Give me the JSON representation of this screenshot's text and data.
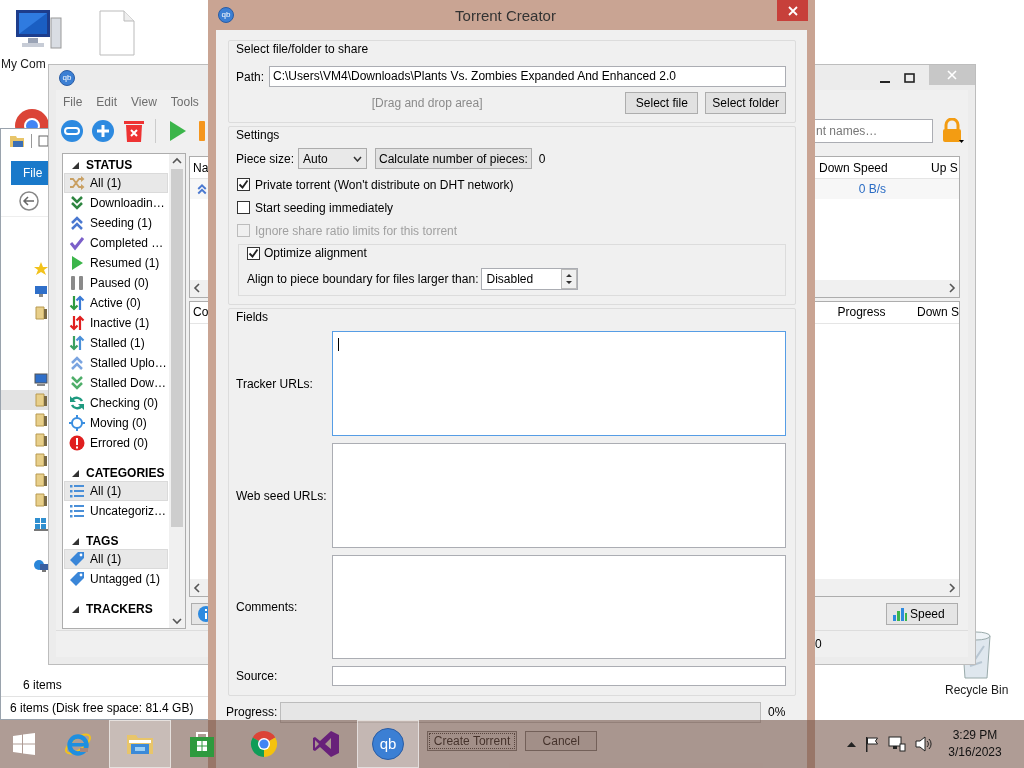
{
  "desktop": {
    "icons": [
      {
        "kind": "computer",
        "label": "My Com"
      },
      {
        "kind": "file"
      },
      {
        "kind": "browser"
      },
      {
        "kind": "recycle-bin",
        "label": "Recycle Bin"
      }
    ]
  },
  "explorer": {
    "ribbon_tab": "File",
    "navigation_pane": [
      {
        "kind": "favorites",
        "selected": false
      },
      {
        "kind": "desktop",
        "selected": false
      },
      {
        "kind": "folder",
        "selected": false
      },
      {
        "kind": "this-pc",
        "selected": false
      },
      {
        "kind": "folder",
        "selected": true
      },
      {
        "kind": "folder",
        "selected": false
      },
      {
        "kind": "folder",
        "selected": false
      },
      {
        "kind": "folder",
        "selected": false
      },
      {
        "kind": "folder",
        "selected": false
      },
      {
        "kind": "folder",
        "selected": false
      },
      {
        "kind": "drive",
        "selected": false
      },
      {
        "kind": "network",
        "selected": false
      }
    ],
    "item_count": "6 items",
    "status_bar": "6 items (Disk free space: 81.4 GB)"
  },
  "qbittorrent": {
    "icon_text": "qb",
    "menu": [
      "File",
      "Edit",
      "View",
      "Tools"
    ],
    "toolbar": [
      {
        "kind": "add-link"
      },
      {
        "kind": "add"
      },
      {
        "kind": "delete"
      },
      {
        "kind": "separator"
      },
      {
        "kind": "resume"
      },
      {
        "kind": "pause"
      }
    ],
    "search": {
      "placeholder": "nt names…"
    },
    "sidebar": [
      {
        "title": "STATUS",
        "expanded": true,
        "items": [
          {
            "kind": "shuffle",
            "label": "All (1)",
            "selected": true
          },
          {
            "kind": "downloading",
            "label": "Downloadin…",
            "selected": false
          },
          {
            "kind": "seeding",
            "label": "Seeding (1)",
            "selected": false
          },
          {
            "kind": "completed",
            "label": "Completed …",
            "selected": false
          },
          {
            "kind": "resumed",
            "label": "Resumed (1)",
            "selected": false
          },
          {
            "kind": "paused",
            "label": "Paused (0)",
            "selected": false
          },
          {
            "kind": "active",
            "label": "Active (0)",
            "selected": false
          },
          {
            "kind": "inactive",
            "label": "Inactive (1)",
            "selected": false
          },
          {
            "kind": "stalled",
            "label": "Stalled (1)",
            "selected": false
          },
          {
            "kind": "stalled-uploading",
            "label": "Stalled Uplo…",
            "selected": false
          },
          {
            "kind": "stalled-downloading",
            "label": "Stalled Dow…",
            "selected": false
          },
          {
            "kind": "checking",
            "label": "Checking (0)",
            "selected": false
          },
          {
            "kind": "moving",
            "label": "Moving (0)",
            "selected": false
          },
          {
            "kind": "errored",
            "label": "Errored (0)",
            "selected": false
          }
        ]
      },
      {
        "title": "CATEGORIES",
        "expanded": true,
        "items": [
          {
            "kind": "category",
            "label": "All (1)",
            "selected": true
          },
          {
            "kind": "category",
            "label": "Uncategoriz…",
            "selected": false
          }
        ]
      },
      {
        "title": "TAGS",
        "expanded": true,
        "items": [
          {
            "kind": "tag",
            "label": "All (1)",
            "selected": true
          },
          {
            "kind": "tag",
            "label": "Untagged (1)",
            "selected": false
          }
        ]
      },
      {
        "title": "TRACKERS",
        "expanded": true
      }
    ],
    "transfers": {
      "columns": [
        "Na",
        "Down Speed",
        "Up S"
      ],
      "rows": [
        {
          "kind": "seeding",
          "down_speed": "0 B/s"
        }
      ]
    },
    "properties": {
      "columns": [
        "Co",
        "Progress",
        "Down S"
      ]
    },
    "speed_button": "Speed",
    "status_text": "0"
  },
  "torrent_creator": {
    "title": "Torrent Creator",
    "icon_text": "qb",
    "share": {
      "title": "Select file/folder to share",
      "path_label": "Path:",
      "path": "C:\\Users\\VM4\\Downloads\\Plants Vs. Zombies Expanded And Enhanced 2.0",
      "drop_hint": "[Drag and drop area]",
      "buttons": [
        "Select file",
        "Select folder"
      ]
    },
    "settings": {
      "title": "Settings",
      "piece_size_label": "Piece size:",
      "piece_size": "Auto",
      "calculate_button": "Calculate number of pieces:",
      "pieces_count": "0",
      "options": [
        {
          "label": "Private torrent (Won't distribute on DHT network)",
          "checked": true,
          "disabled": false
        },
        {
          "label": "Start seeding immediately",
          "checked": false,
          "disabled": false
        },
        {
          "label": "Ignore share ratio limits for this torrent",
          "checked": false,
          "disabled": true
        }
      ],
      "optimize": {
        "label": "Optimize alignment",
        "checked": true
      },
      "align_label": "Align to piece boundary for files larger than:",
      "align_value": "Disabled"
    },
    "fields": {
      "title": "Fields",
      "rows": [
        {
          "label": "Tracker URLs:",
          "kind": "multiline",
          "focused": true
        },
        {
          "label": "Web seed URLs:",
          "kind": "multiline",
          "focused": false
        },
        {
          "label": "Comments:",
          "kind": "multiline",
          "focused": false
        },
        {
          "label": "Source:",
          "kind": "line",
          "focused": false
        }
      ]
    },
    "progress": {
      "label": "Progress:",
      "level": 0,
      "reading": "0%"
    },
    "buttons": [
      "Create Torrent",
      "Cancel"
    ]
  },
  "taskbar": {
    "apps": [
      {
        "kind": "start",
        "active": false
      },
      {
        "kind": "internet-explorer",
        "active": false
      },
      {
        "kind": "file-explorer",
        "active": true
      },
      {
        "kind": "store",
        "active": false
      },
      {
        "kind": "chrome",
        "active": false
      },
      {
        "kind": "visual-studio",
        "active": false
      },
      {
        "kind": "qbittorrent",
        "active": true,
        "icon_text": "qb"
      }
    ],
    "time": "3:29 PM",
    "date": "3/16/2023"
  }
}
